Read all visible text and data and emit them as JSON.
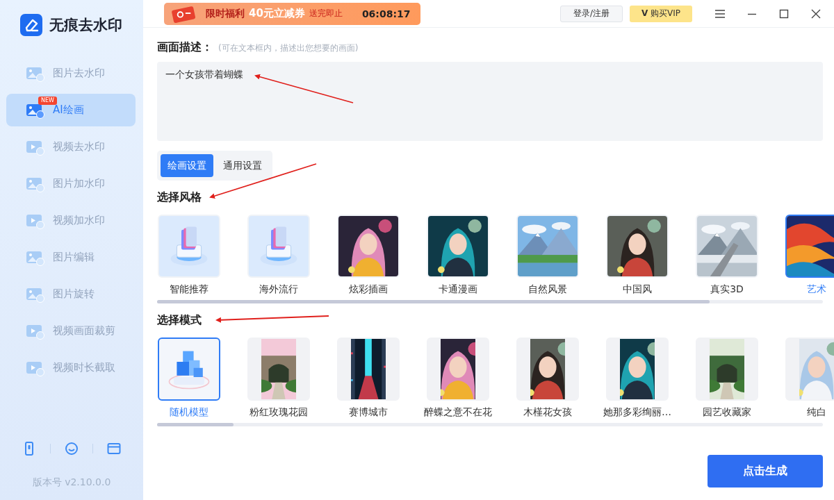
{
  "app": {
    "name": "无痕去水印"
  },
  "sidebar": {
    "items": [
      {
        "label": "图片去水印",
        "selected": false
      },
      {
        "label": "AI绘画",
        "selected": true,
        "badge": "NEW"
      },
      {
        "label": "视频去水印",
        "selected": false
      },
      {
        "label": "图片加水印",
        "selected": false
      },
      {
        "label": "视频加水印",
        "selected": false
      },
      {
        "label": "图片编辑",
        "selected": false
      },
      {
        "label": "图片旋转",
        "selected": false
      },
      {
        "label": "视频画面裁剪",
        "selected": false
      },
      {
        "label": "视频时长截取",
        "selected": false
      }
    ],
    "version": "版本号 v2.10.0.0"
  },
  "promo": {
    "title": "限时福利",
    "offer": "40元立减券",
    "note": "送完即止",
    "countdown": "06:08:17"
  },
  "header": {
    "login": "登录/注册",
    "vip_mark": "V",
    "vip": "购买VIP"
  },
  "prompt": {
    "label": "画面描述：",
    "hint": "(可在文本框内，描述出您想要的画面)",
    "value": "一个女孩带着蝴蝶"
  },
  "tabs": [
    {
      "label": "绘画设置",
      "selected": true
    },
    {
      "label": "通用设置",
      "selected": false
    }
  ],
  "styles": {
    "title": "选择风格",
    "items": [
      {
        "label": "智能推荐",
        "kind": "icon",
        "selected": false
      },
      {
        "label": "海外流行",
        "kind": "icon",
        "selected": false
      },
      {
        "label": "炫彩插画",
        "kind": "picture",
        "selected": false
      },
      {
        "label": "卡通漫画",
        "kind": "picture",
        "selected": false
      },
      {
        "label": "自然风景",
        "kind": "picture",
        "selected": false
      },
      {
        "label": "中国风",
        "kind": "picture",
        "selected": false
      },
      {
        "label": "真实3D",
        "kind": "picture",
        "selected": false
      },
      {
        "label": "艺术",
        "kind": "picture",
        "selected": true
      }
    ]
  },
  "modes": {
    "title": "选择模式",
    "items": [
      {
        "label": "随机模型",
        "kind": "icon",
        "selected": true
      },
      {
        "label": "粉红玫瑰花园",
        "kind": "picture",
        "selected": false
      },
      {
        "label": "赛博城市",
        "kind": "picture",
        "selected": false
      },
      {
        "label": "醉蝶之意不在花",
        "kind": "picture",
        "selected": false
      },
      {
        "label": "木槿花女孩",
        "kind": "picture",
        "selected": false
      },
      {
        "label": "她那多彩绚丽…",
        "kind": "picture",
        "selected": false
      },
      {
        "label": "园艺收藏家",
        "kind": "picture",
        "selected": false
      },
      {
        "label": "纯白",
        "kind": "picture",
        "selected": false
      }
    ]
  },
  "generate_button": "点击生成"
}
